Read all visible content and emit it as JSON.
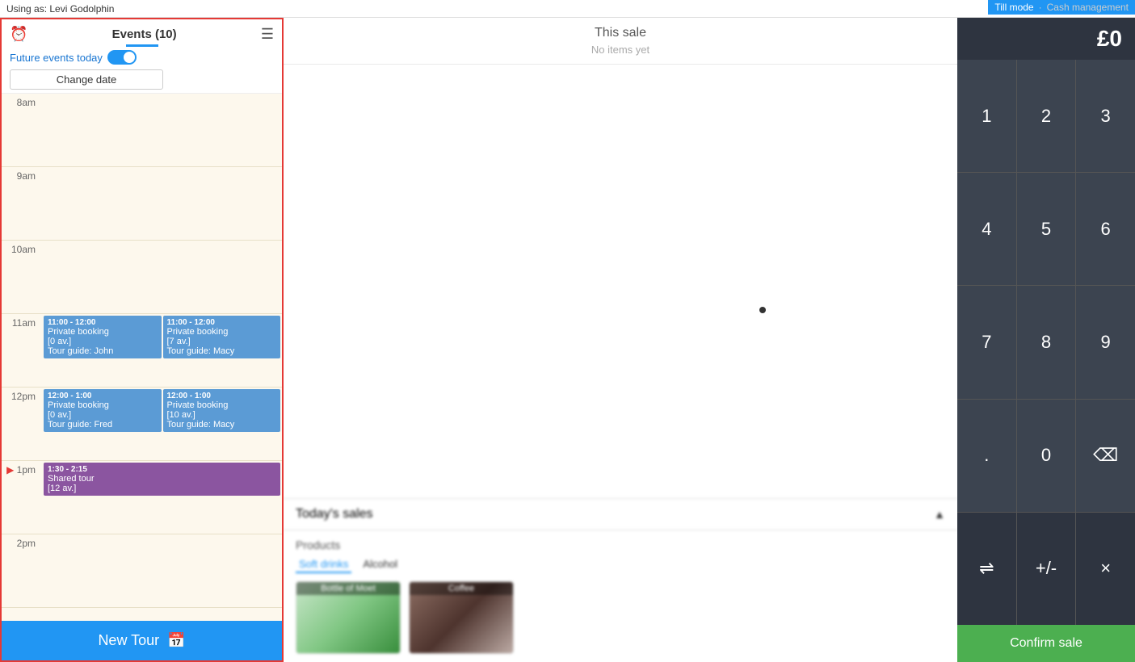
{
  "topbar": {
    "user_label": "Using as: Levi Godolphin",
    "till_mode": "Till mode",
    "cash_management": "Cash management"
  },
  "left_panel": {
    "events_title": "Events (10)",
    "future_events_label": "Future events today",
    "toggle_on": false,
    "change_date_label": "Change date",
    "time_slots": [
      {
        "label": "8am",
        "events": []
      },
      {
        "label": "9am",
        "events": []
      },
      {
        "label": "10am",
        "events": []
      },
      {
        "label": "11am",
        "events": [
          {
            "time": "11:00 - 12:00",
            "name": "Private booking",
            "av": "[0 av.]",
            "guide": "Tour guide: John",
            "color": "blue"
          },
          {
            "time": "11:00 - 12:00",
            "name": "Private booking",
            "av": "[7 av.]",
            "guide": "Tour guide: Macy",
            "color": "blue"
          }
        ]
      },
      {
        "label": "12pm",
        "events": [
          {
            "time": "12:00 - 1:00",
            "name": "Private booking",
            "av": "[0 av.]",
            "guide": "Tour guide: Fred",
            "color": "blue"
          },
          {
            "time": "12:00 - 1:00",
            "name": "Private booking",
            "av": "[10 av.]",
            "guide": "Tour guide: Macy",
            "color": "blue"
          }
        ]
      },
      {
        "label": "1pm",
        "events": [
          {
            "time": "1:30 - 2:15",
            "name": "Shared tour",
            "av": "[12 av.]",
            "guide": "",
            "color": "purple"
          }
        ]
      },
      {
        "label": "2pm",
        "events": []
      }
    ],
    "new_tour_label": "New Tour"
  },
  "middle_panel": {
    "this_sale_title": "This sale",
    "no_items_text": "No items yet",
    "todays_sales_label": "Today's sales",
    "products_title": "Products",
    "product_tabs": [
      "Soft drinks",
      "Alcohol"
    ],
    "products": [
      {
        "name": "Bottle of Moet",
        "img_class": "img-bottle"
      },
      {
        "name": "Coffee",
        "img_class": "img-coffee"
      }
    ]
  },
  "numpad": {
    "display_value": "£0",
    "buttons": [
      "1",
      "2",
      "3",
      "4",
      "5",
      "6",
      "7",
      "8",
      "9",
      ".",
      "0",
      "⌫",
      "⇌",
      "+/-",
      "×"
    ],
    "confirm_label": "Confirm sale"
  }
}
